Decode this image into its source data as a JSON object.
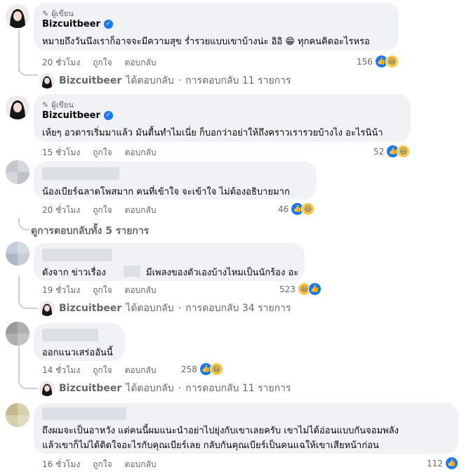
{
  "author_badge": "ผู้เขียน",
  "c1": {
    "name": "Bizcuitbeer",
    "text": "หมายถึงวันนึงเราก็อาจจะมีความสุข ร่ำรวยแบบเขาบ้างน่ะ อิอิ 😁 ทุกคนคิดอะไรหรอ",
    "time": "20 ชั่วโมง",
    "like": "ถูกใจ",
    "reply": "ตอบกลับ",
    "count": "156"
  },
  "r1": {
    "name": "Bizcuitbeer",
    "replied": "ได้ตอบกลับ",
    "sep": "·",
    "count": "การตอบกลับ 11 รายการ"
  },
  "c2": {
    "name": "Bizcuitbeer",
    "text": "เห้ยๆ อวตารเริ่มมาแล้ว มันตื้นทำไมเนี่ย ก็บอกว่าอย่าให้ถึงคราวเรารวยบ้างไง อะไรนิน้า",
    "time": "15 ชั่วโมง",
    "like": "ถูกใจ",
    "reply": "ตอบกลับ",
    "count": "52"
  },
  "c3": {
    "text": "น้องเบียร์ฉลาดโพสมาก คนที่เข้าใจ จะเข้าใจ ไม่ต้องอธิบายมาก",
    "time": "20 ชั่วโมง",
    "like": "ถูกใจ",
    "reply": "ตอบกลับ",
    "count": "46"
  },
  "see_all": "ดูการตอบกลับทั้ง 5 รายการ",
  "c4": {
    "text_a": "ดังจาก ข่าวเรื่อง",
    "text_b": "มีเพลงของตัวเองบ้างไหมเป็นนักร้อง อะ",
    "time": "19 ชั่วโมง",
    "like": "ถูกใจ",
    "reply": "ตอบกลับ",
    "count": "523"
  },
  "r2": {
    "name": "Bizcuitbeer",
    "replied": "ได้ตอบกลับ",
    "sep": "·",
    "count": "การตอบกลับ 34 รายการ"
  },
  "c5": {
    "text": "ออกแนวเสร่ออันนี้",
    "time": "14 ชั่วโมง",
    "like": "ถูกใจ",
    "reply": "ตอบกลับ",
    "count": "258"
  },
  "r3": {
    "name": "Bizcuitbeer",
    "replied": "ได้ตอบกลับ",
    "sep": "·",
    "count": "การตอบกลับ 11 รายการ"
  },
  "c6": {
    "line1": "ถึงผมจะเป็นอาหวัง แต่คนนี้ผมแนะนำอย่าไปยุ่งกับเขาเลยครับ เขาไม่ได้อ่อนแบบกันจอมพลัง",
    "line2": "แล้วเขาก็ไม่ได้ติดใจอะไรกับคุณเบียร์เลย กลับกันคุณเบียร์เป็นคนแฉให้เขาเสียหน้าก่อน",
    "time": "16 ชั่วโมง",
    "like": "ถูกใจ",
    "reply": "ตอบกลับ",
    "count": "112"
  },
  "icons": {
    "pen": "pen-icon",
    "verified": "verified-check-icon",
    "like": "like-reaction-icon",
    "haha": "haha-reaction-icon",
    "reply_arrow": "reply-arrow-icon"
  },
  "colors": {
    "bubble": "#f0f2f5",
    "meta": "#65676b",
    "like": "#1877f2",
    "haha": "#f7c84b"
  }
}
